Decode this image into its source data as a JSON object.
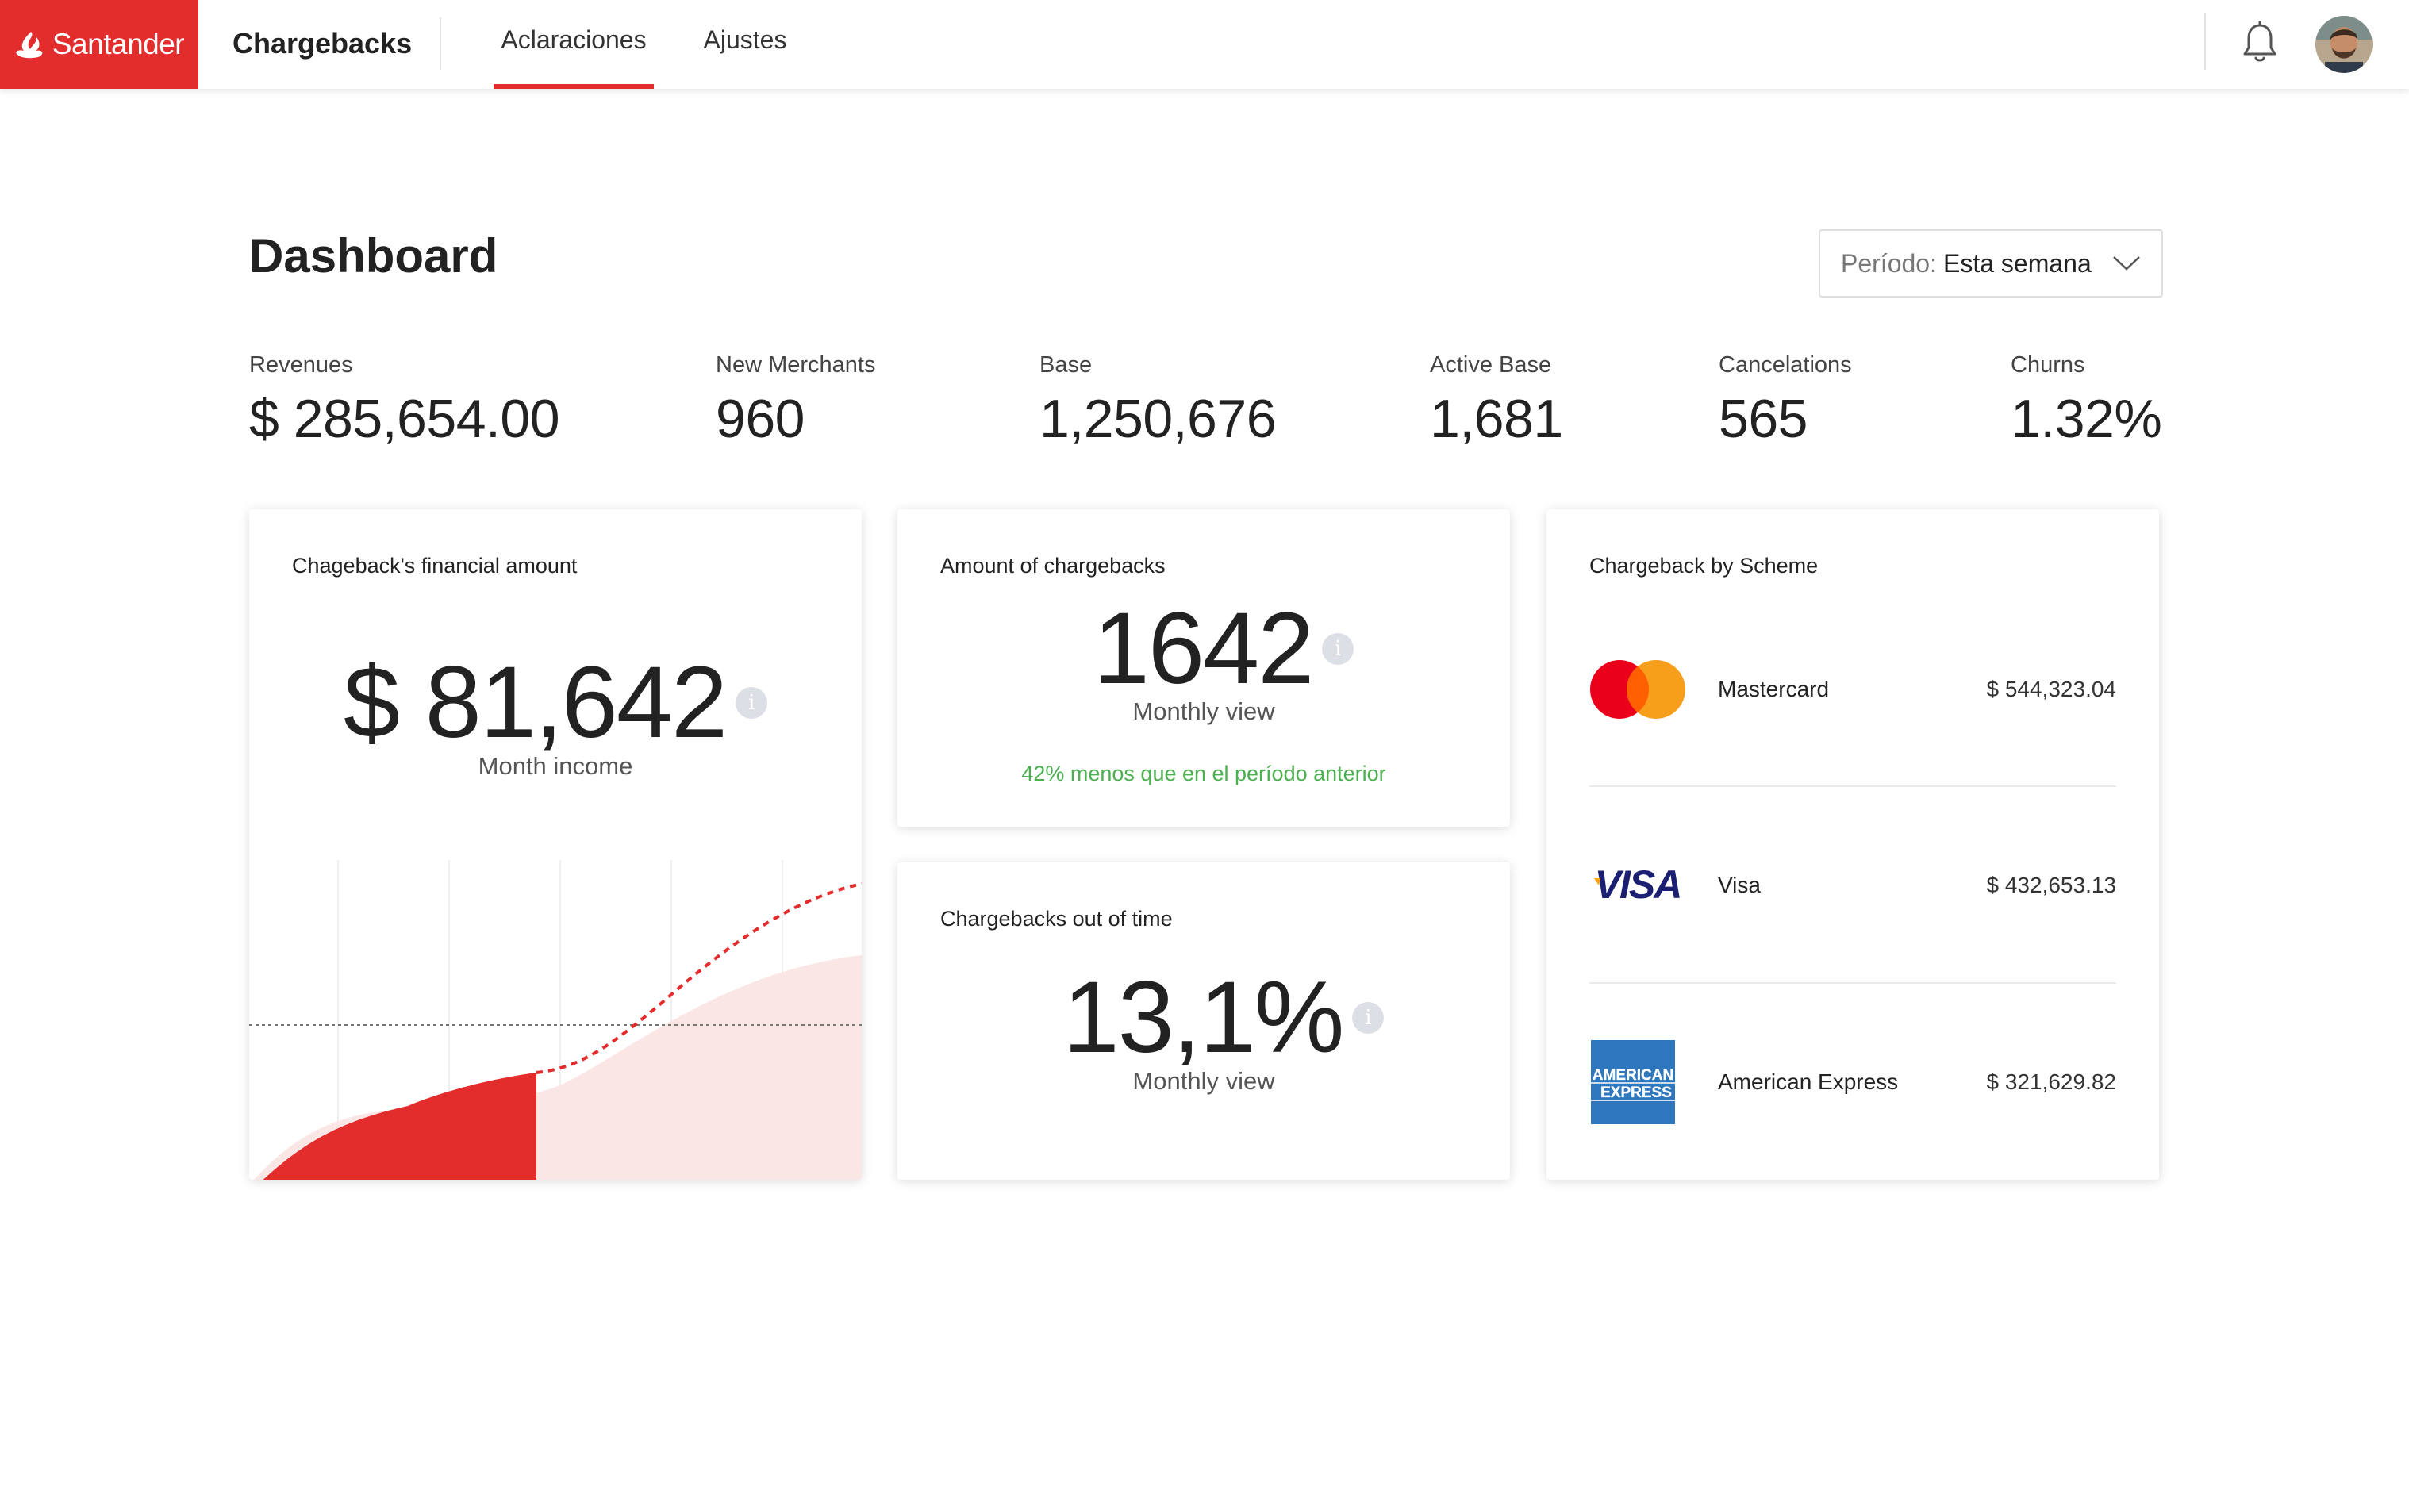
{
  "header": {
    "brand": "Santander",
    "app_title": "Chargebacks",
    "tabs": [
      {
        "label": "Aclaraciones",
        "active": true
      },
      {
        "label": "Ajustes",
        "active": false
      }
    ],
    "icons": [
      "santander-flame-icon",
      "bell-icon",
      "user-avatar"
    ]
  },
  "page": {
    "title": "Dashboard",
    "period_label": "Período:",
    "period_value": "Esta semana"
  },
  "kpis": [
    {
      "label": "Revenues",
      "value": "$ 285,654.00"
    },
    {
      "label": "New Merchants",
      "value": "960"
    },
    {
      "label": "Base",
      "value": "1,250,676"
    },
    {
      "label": "Active Base",
      "value": "1,681"
    },
    {
      "label": "Cancelations",
      "value": "565"
    },
    {
      "label": "Churns",
      "value": "1.32%"
    }
  ],
  "cards": {
    "financial": {
      "title": "Chageback's financial amount",
      "value": "$ 81,642",
      "sub": "Month income"
    },
    "amount": {
      "title": "Amount of chargebacks",
      "value": "1642",
      "sub": "Monthly view",
      "note": "42% menos que en el período anterior"
    },
    "out_of_time": {
      "title": "Chargebacks out of time",
      "value": "13,1%",
      "sub": "Monthly view"
    },
    "scheme": {
      "title": "Chargeback by Scheme",
      "rows": [
        {
          "name": "Mastercard",
          "amount": "$ 544,323.04",
          "logo": "mastercard-logo"
        },
        {
          "name": "Visa",
          "amount": "$ 432,653.13",
          "logo": "visa-logo",
          "logo_text": "VISA"
        },
        {
          "name": "American Express",
          "amount": "$ 321,629.82",
          "logo": "amex-logo",
          "logo_text": [
            "AMERICAN",
            "EXPRESS"
          ]
        }
      ]
    }
  },
  "colors": {
    "brand_red": "#e32d2d",
    "chart_fill_light": "#fbe6e6",
    "positive_green": "#4caf50",
    "mastercard_red": "#eb001b",
    "mastercard_orange": "#f79e1b",
    "visa_blue": "#1a1f71",
    "visa_gold": "#f7a600",
    "amex_blue": "#2e77bc"
  }
}
